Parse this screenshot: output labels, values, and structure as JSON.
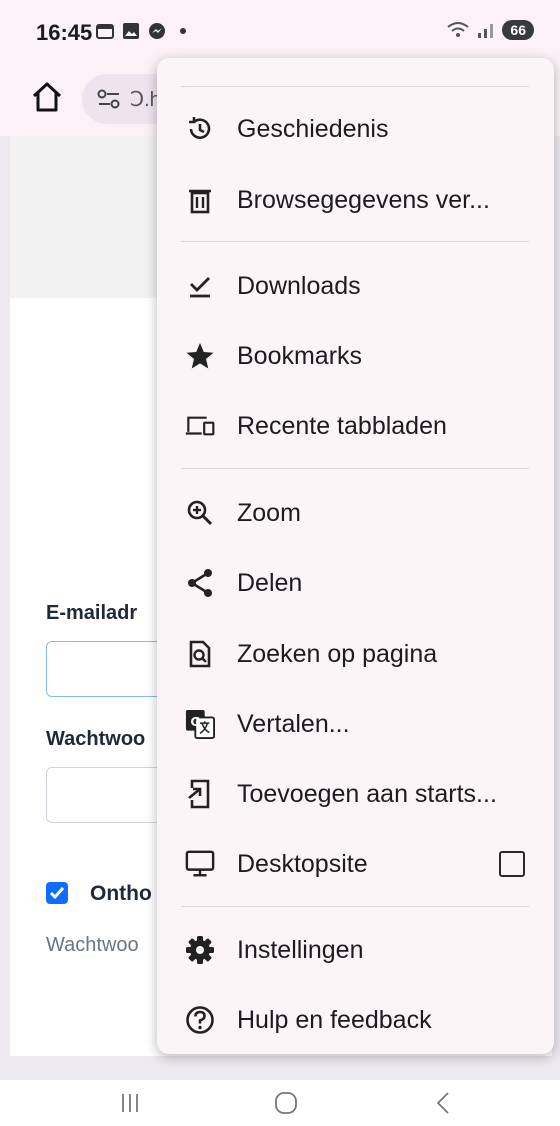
{
  "status_bar": {
    "time": "16:45",
    "battery": "66"
  },
  "toolbar": {
    "url_fragment": "Ↄ.h"
  },
  "page": {
    "email_label": "E-mailadr",
    "password_label": "Wachtwoo",
    "remember_label": "Ontho",
    "forgot_label": "Wachtwoo"
  },
  "menu": {
    "items": [
      {
        "label": "Geschiedenis",
        "icon": "history-icon"
      },
      {
        "label": "Browsegegevens ver...",
        "icon": "trash-icon"
      },
      {
        "label": "Downloads",
        "icon": "download-done-icon"
      },
      {
        "label": "Bookmarks",
        "icon": "star-icon"
      },
      {
        "label": "Recente tabbladen",
        "icon": "devices-icon"
      },
      {
        "label": "Zoom",
        "icon": "zoom-in-icon"
      },
      {
        "label": "Delen",
        "icon": "share-icon"
      },
      {
        "label": "Zoeken op pagina",
        "icon": "find-in-page-icon"
      },
      {
        "label": "Vertalen...",
        "icon": "translate-icon"
      },
      {
        "label": "Toevoegen aan starts...",
        "icon": "add-to-home-icon"
      },
      {
        "label": "Desktopsite",
        "icon": "desktop-icon",
        "checked": false
      },
      {
        "label": "Instellingen",
        "icon": "gear-icon"
      },
      {
        "label": "Hulp en feedback",
        "icon": "help-icon"
      }
    ]
  },
  "colors": {
    "accent": "#0d6efd",
    "menu_bg": "#fcf5f8",
    "toolbar_bg": "#fbf1f6"
  }
}
